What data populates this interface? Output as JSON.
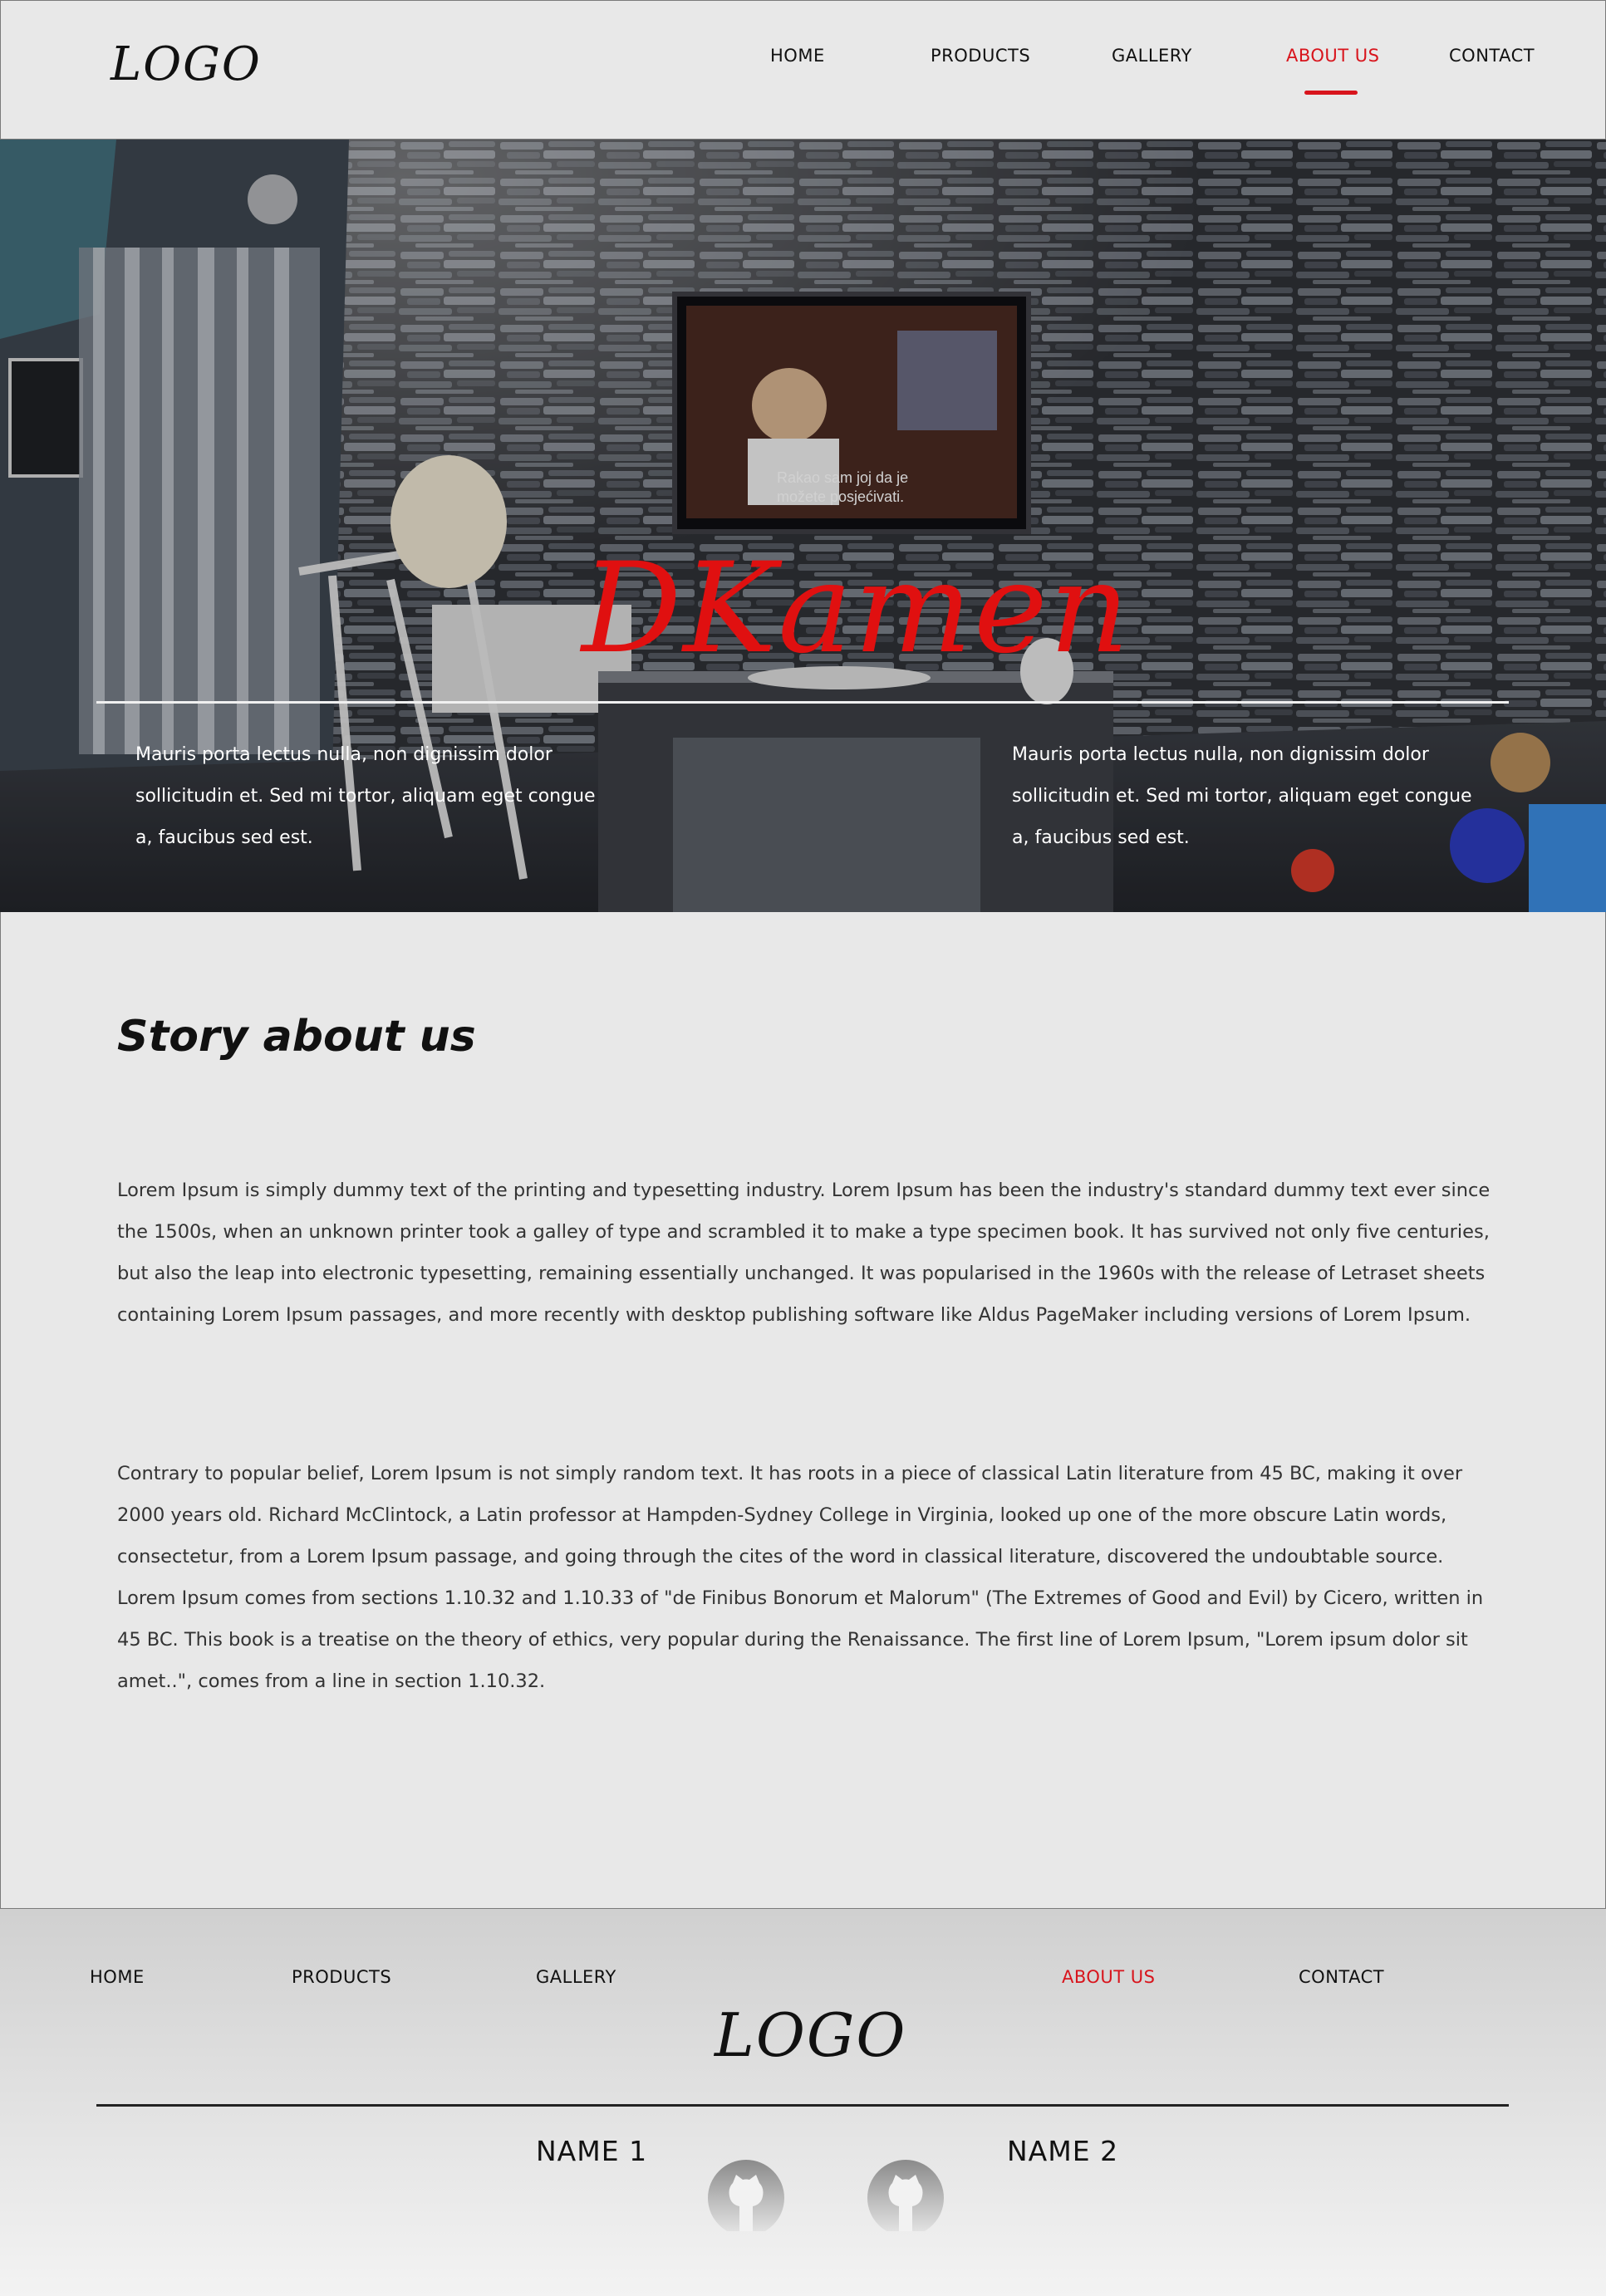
{
  "header": {
    "logo": "LOGO",
    "nav": [
      "HOME",
      "PRODUCTS",
      "GALLERY",
      "ABOUT US",
      "CONTACT"
    ],
    "active": "ABOUT US"
  },
  "hero": {
    "title": "DKamen",
    "tv_caption_1": "Rakao sam joj da je",
    "tv_caption_2": "možete posjećivati.",
    "left_text": "Mauris porta lectus nulla, non dignissim dolor sollicitudin et. Sed mi tortor, aliquam eget congue a, faucibus sed est.",
    "right_text": "Mauris porta lectus nulla, non dignissim dolor sollicitudin et. Sed mi tortor, aliquam eget congue a, faucibus sed est."
  },
  "story": {
    "heading": "Story about us",
    "paragraph_1": "Lorem Ipsum is simply dummy text of the printing and typesetting industry. Lorem Ipsum has been the industry's standard dummy text ever since the 1500s, when an unknown printer took a galley of type and scrambled it to make a type specimen book. It has survived not only five centuries, but also the leap into electronic typesetting, remaining essentially unchanged. It was popularised in the 1960s with the release of Letraset sheets containing Lorem Ipsum passages, and more recently with desktop publishing software like Aldus PageMaker including versions of Lorem Ipsum.",
    "paragraph_2": "Contrary to popular belief, Lorem Ipsum is not simply random text. It has roots in a piece of classical Latin literature from 45 BC, making it over 2000 years old. Richard McClintock, a Latin professor at Hampden-Sydney College in Virginia, looked up one of the more obscure Latin words, consectetur, from a Lorem Ipsum passage, and going through the cites of the word in classical literature, discovered the undoubtable source. Lorem Ipsum comes from sections 1.10.32 and 1.10.33 of \"de Finibus Bonorum et Malorum\" (The Extremes of Good and Evil) by Cicero, written in 45 BC. This book is a treatise on the theory of ethics, very popular during the Renaissance. The first line of Lorem Ipsum, \"Lorem ipsum dolor sit amet..\", comes from a line in section 1.10.32."
  },
  "footer": {
    "nav": [
      "HOME",
      "PRODUCTS",
      "GALLERY",
      "ABOUT US",
      "CONTACT"
    ],
    "logo": "LOGO",
    "name_1": "NAME 1",
    "name_2": "NAME 2",
    "icons": [
      "github-icon",
      "github-icon"
    ]
  },
  "colors": {
    "accent": "#d8141c",
    "page_background": "#e8e8e8",
    "hero_title": "#e01010"
  }
}
